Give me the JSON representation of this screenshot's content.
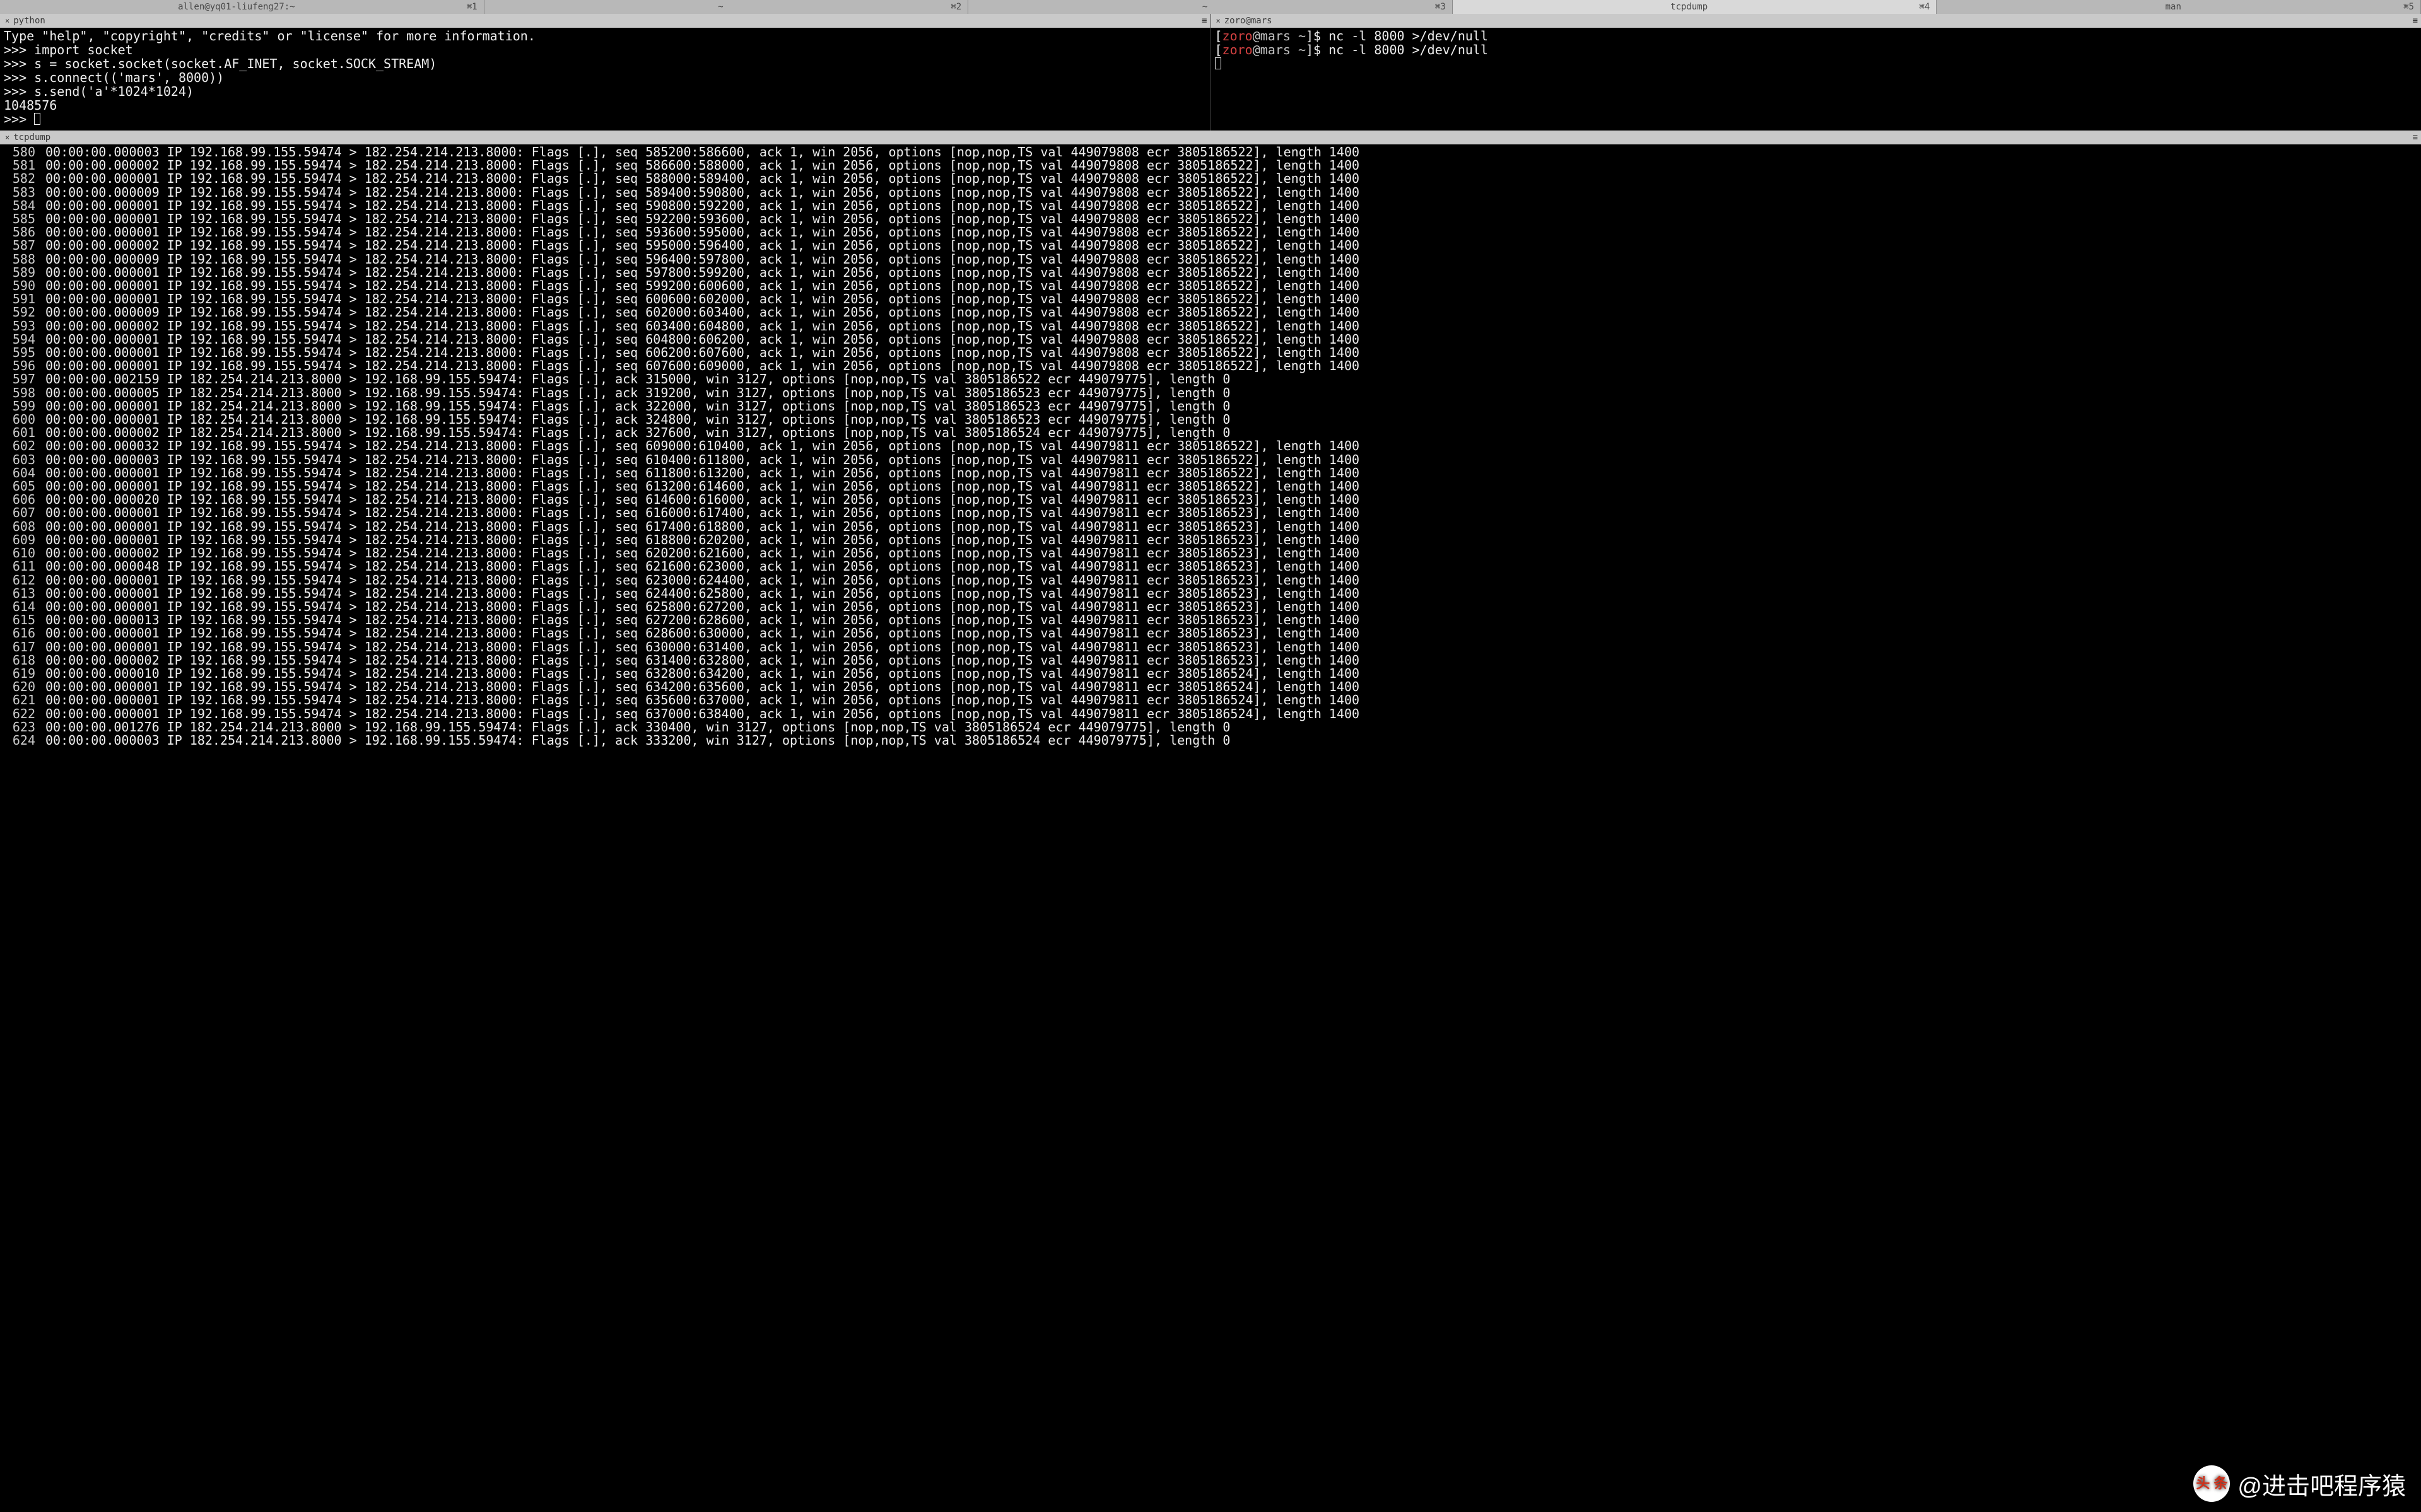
{
  "tabs": [
    {
      "title": "allen@yq01-liufeng27:~",
      "key": "⌘1",
      "active": false
    },
    {
      "title": "~",
      "key": "⌘2",
      "active": false
    },
    {
      "title": "~",
      "key": "⌘3",
      "active": false
    },
    {
      "title": "tcpdump",
      "key": "⌘4",
      "active": true
    },
    {
      "title": "man",
      "key": "⌘5",
      "active": false
    }
  ],
  "pane_left": {
    "title": "python",
    "lines": [
      "Type \"help\", \"copyright\", \"credits\" or \"license\" for more information.",
      ">>> import socket",
      ">>> s = socket.socket(socket.AF_INET, socket.SOCK_STREAM)",
      ">>> s.connect(('mars', 8000))",
      ">>> s.send('a'*1024*1024)",
      "1048576",
      ">>> "
    ]
  },
  "pane_right": {
    "title": "zoro@mars",
    "prompt": {
      "user": "zoro",
      "host": "@mars ~",
      "end": "]$ "
    },
    "lines": [
      "nc -l 8000 >/dev/null",
      "nc -l 8000 >/dev/null"
    ]
  },
  "tcpdump_title": "tcpdump",
  "tcpdump": {
    "src_fwd": "IP 192.168.99.155.59474 > 182.254.214.213.8000:",
    "src_rev": "IP 182.254.214.213.8000 > 192.168.99.155.59474:",
    "lines": [
      {
        "n": 580,
        "t": "00:00:00.000003",
        "dir": "fwd",
        "rest": "Flags [.], seq 585200:586600, ack 1, win 2056, options [nop,nop,TS val 449079808 ecr 3805186522], length 1400"
      },
      {
        "n": 581,
        "t": "00:00:00.000002",
        "dir": "fwd",
        "rest": "Flags [.], seq 586600:588000, ack 1, win 2056, options [nop,nop,TS val 449079808 ecr 3805186522], length 1400"
      },
      {
        "n": 582,
        "t": "00:00:00.000001",
        "dir": "fwd",
        "rest": "Flags [.], seq 588000:589400, ack 1, win 2056, options [nop,nop,TS val 449079808 ecr 3805186522], length 1400"
      },
      {
        "n": 583,
        "t": "00:00:00.000009",
        "dir": "fwd",
        "rest": "Flags [.], seq 589400:590800, ack 1, win 2056, options [nop,nop,TS val 449079808 ecr 3805186522], length 1400"
      },
      {
        "n": 584,
        "t": "00:00:00.000001",
        "dir": "fwd",
        "rest": "Flags [.], seq 590800:592200, ack 1, win 2056, options [nop,nop,TS val 449079808 ecr 3805186522], length 1400"
      },
      {
        "n": 585,
        "t": "00:00:00.000001",
        "dir": "fwd",
        "rest": "Flags [.], seq 592200:593600, ack 1, win 2056, options [nop,nop,TS val 449079808 ecr 3805186522], length 1400"
      },
      {
        "n": 586,
        "t": "00:00:00.000001",
        "dir": "fwd",
        "rest": "Flags [.], seq 593600:595000, ack 1, win 2056, options [nop,nop,TS val 449079808 ecr 3805186522], length 1400"
      },
      {
        "n": 587,
        "t": "00:00:00.000002",
        "dir": "fwd",
        "rest": "Flags [.], seq 595000:596400, ack 1, win 2056, options [nop,nop,TS val 449079808 ecr 3805186522], length 1400"
      },
      {
        "n": 588,
        "t": "00:00:00.000009",
        "dir": "fwd",
        "rest": "Flags [.], seq 596400:597800, ack 1, win 2056, options [nop,nop,TS val 449079808 ecr 3805186522], length 1400"
      },
      {
        "n": 589,
        "t": "00:00:00.000001",
        "dir": "fwd",
        "rest": "Flags [.], seq 597800:599200, ack 1, win 2056, options [nop,nop,TS val 449079808 ecr 3805186522], length 1400"
      },
      {
        "n": 590,
        "t": "00:00:00.000001",
        "dir": "fwd",
        "rest": "Flags [.], seq 599200:600600, ack 1, win 2056, options [nop,nop,TS val 449079808 ecr 3805186522], length 1400"
      },
      {
        "n": 591,
        "t": "00:00:00.000001",
        "dir": "fwd",
        "rest": "Flags [.], seq 600600:602000, ack 1, win 2056, options [nop,nop,TS val 449079808 ecr 3805186522], length 1400"
      },
      {
        "n": 592,
        "t": "00:00:00.000009",
        "dir": "fwd",
        "rest": "Flags [.], seq 602000:603400, ack 1, win 2056, options [nop,nop,TS val 449079808 ecr 3805186522], length 1400"
      },
      {
        "n": 593,
        "t": "00:00:00.000002",
        "dir": "fwd",
        "rest": "Flags [.], seq 603400:604800, ack 1, win 2056, options [nop,nop,TS val 449079808 ecr 3805186522], length 1400"
      },
      {
        "n": 594,
        "t": "00:00:00.000001",
        "dir": "fwd",
        "rest": "Flags [.], seq 604800:606200, ack 1, win 2056, options [nop,nop,TS val 449079808 ecr 3805186522], length 1400"
      },
      {
        "n": 595,
        "t": "00:00:00.000001",
        "dir": "fwd",
        "rest": "Flags [.], seq 606200:607600, ack 1, win 2056, options [nop,nop,TS val 449079808 ecr 3805186522], length 1400"
      },
      {
        "n": 596,
        "t": "00:00:00.000001",
        "dir": "fwd",
        "rest": "Flags [.], seq 607600:609000, ack 1, win 2056, options [nop,nop,TS val 449079808 ecr 3805186522], length 1400"
      },
      {
        "n": 597,
        "t": "00:00:00.002159",
        "dir": "rev",
        "rest": "Flags [.], ack 315000, win 3127, options [nop,nop,TS val 3805186522 ecr 449079775], length 0"
      },
      {
        "n": 598,
        "t": "00:00:00.000005",
        "dir": "rev",
        "rest": "Flags [.], ack 319200, win 3127, options [nop,nop,TS val 3805186523 ecr 449079775], length 0"
      },
      {
        "n": 599,
        "t": "00:00:00.000001",
        "dir": "rev",
        "rest": "Flags [.], ack 322000, win 3127, options [nop,nop,TS val 3805186523 ecr 449079775], length 0"
      },
      {
        "n": 600,
        "t": "00:00:00.000001",
        "dir": "rev",
        "rest": "Flags [.], ack 324800, win 3127, options [nop,nop,TS val 3805186523 ecr 449079775], length 0"
      },
      {
        "n": 601,
        "t": "00:00:00.000002",
        "dir": "rev",
        "rest": "Flags [.], ack 327600, win 3127, options [nop,nop,TS val 3805186524 ecr 449079775], length 0"
      },
      {
        "n": 602,
        "t": "00:00:00.000032",
        "dir": "fwd",
        "rest": "Flags [.], seq 609000:610400, ack 1, win 2056, options [nop,nop,TS val 449079811 ecr 3805186522], length 1400"
      },
      {
        "n": 603,
        "t": "00:00:00.000003",
        "dir": "fwd",
        "rest": "Flags [.], seq 610400:611800, ack 1, win 2056, options [nop,nop,TS val 449079811 ecr 3805186522], length 1400"
      },
      {
        "n": 604,
        "t": "00:00:00.000001",
        "dir": "fwd",
        "rest": "Flags [.], seq 611800:613200, ack 1, win 2056, options [nop,nop,TS val 449079811 ecr 3805186522], length 1400"
      },
      {
        "n": 605,
        "t": "00:00:00.000001",
        "dir": "fwd",
        "rest": "Flags [.], seq 613200:614600, ack 1, win 2056, options [nop,nop,TS val 449079811 ecr 3805186522], length 1400"
      },
      {
        "n": 606,
        "t": "00:00:00.000020",
        "dir": "fwd",
        "rest": "Flags [.], seq 614600:616000, ack 1, win 2056, options [nop,nop,TS val 449079811 ecr 3805186523], length 1400"
      },
      {
        "n": 607,
        "t": "00:00:00.000001",
        "dir": "fwd",
        "rest": "Flags [.], seq 616000:617400, ack 1, win 2056, options [nop,nop,TS val 449079811 ecr 3805186523], length 1400"
      },
      {
        "n": 608,
        "t": "00:00:00.000001",
        "dir": "fwd",
        "rest": "Flags [.], seq 617400:618800, ack 1, win 2056, options [nop,nop,TS val 449079811 ecr 3805186523], length 1400"
      },
      {
        "n": 609,
        "t": "00:00:00.000001",
        "dir": "fwd",
        "rest": "Flags [.], seq 618800:620200, ack 1, win 2056, options [nop,nop,TS val 449079811 ecr 3805186523], length 1400"
      },
      {
        "n": 610,
        "t": "00:00:00.000002",
        "dir": "fwd",
        "rest": "Flags [.], seq 620200:621600, ack 1, win 2056, options [nop,nop,TS val 449079811 ecr 3805186523], length 1400"
      },
      {
        "n": 611,
        "t": "00:00:00.000048",
        "dir": "fwd",
        "rest": "Flags [.], seq 621600:623000, ack 1, win 2056, options [nop,nop,TS val 449079811 ecr 3805186523], length 1400"
      },
      {
        "n": 612,
        "t": "00:00:00.000001",
        "dir": "fwd",
        "rest": "Flags [.], seq 623000:624400, ack 1, win 2056, options [nop,nop,TS val 449079811 ecr 3805186523], length 1400"
      },
      {
        "n": 613,
        "t": "00:00:00.000001",
        "dir": "fwd",
        "rest": "Flags [.], seq 624400:625800, ack 1, win 2056, options [nop,nop,TS val 449079811 ecr 3805186523], length 1400"
      },
      {
        "n": 614,
        "t": "00:00:00.000001",
        "dir": "fwd",
        "rest": "Flags [.], seq 625800:627200, ack 1, win 2056, options [nop,nop,TS val 449079811 ecr 3805186523], length 1400"
      },
      {
        "n": 615,
        "t": "00:00:00.000013",
        "dir": "fwd",
        "rest": "Flags [.], seq 627200:628600, ack 1, win 2056, options [nop,nop,TS val 449079811 ecr 3805186523], length 1400"
      },
      {
        "n": 616,
        "t": "00:00:00.000001",
        "dir": "fwd",
        "rest": "Flags [.], seq 628600:630000, ack 1, win 2056, options [nop,nop,TS val 449079811 ecr 3805186523], length 1400"
      },
      {
        "n": 617,
        "t": "00:00:00.000001",
        "dir": "fwd",
        "rest": "Flags [.], seq 630000:631400, ack 1, win 2056, options [nop,nop,TS val 449079811 ecr 3805186523], length 1400"
      },
      {
        "n": 618,
        "t": "00:00:00.000002",
        "dir": "fwd",
        "rest": "Flags [.], seq 631400:632800, ack 1, win 2056, options [nop,nop,TS val 449079811 ecr 3805186523], length 1400"
      },
      {
        "n": 619,
        "t": "00:00:00.000010",
        "dir": "fwd",
        "rest": "Flags [.], seq 632800:634200, ack 1, win 2056, options [nop,nop,TS val 449079811 ecr 3805186524], length 1400"
      },
      {
        "n": 620,
        "t": "00:00:00.000001",
        "dir": "fwd",
        "rest": "Flags [.], seq 634200:635600, ack 1, win 2056, options [nop,nop,TS val 449079811 ecr 3805186524], length 1400"
      },
      {
        "n": 621,
        "t": "00:00:00.000001",
        "dir": "fwd",
        "rest": "Flags [.], seq 635600:637000, ack 1, win 2056, options [nop,nop,TS val 449079811 ecr 3805186524], length 1400"
      },
      {
        "n": 622,
        "t": "00:00:00.000001",
        "dir": "fwd",
        "rest": "Flags [.], seq 637000:638400, ack 1, win 2056, options [nop,nop,TS val 449079811 ecr 3805186524], length 1400"
      },
      {
        "n": 623,
        "t": "00:00:00.001276",
        "dir": "rev",
        "rest": "Flags [.], ack 330400, win 3127, options [nop,nop,TS val 3805186524 ecr 449079775], length 0"
      },
      {
        "n": 624,
        "t": "00:00:00.000003",
        "dir": "rev",
        "rest": "Flags [.], ack 333200, win 3127, options [nop,nop,TS val 3805186524 ecr 449079775], length 0"
      }
    ]
  },
  "watermark": {
    "logo_text": "头 条",
    "text": "@进击吧程序猿"
  }
}
